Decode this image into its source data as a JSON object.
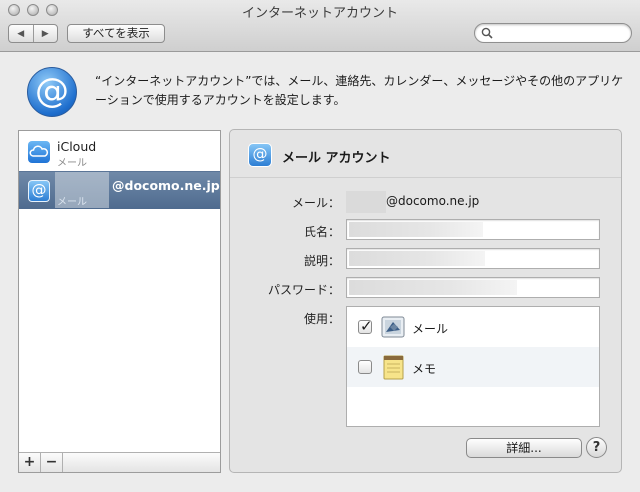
{
  "window": {
    "title": "インターネットアカウント"
  },
  "toolbar": {
    "back": "◀",
    "forward": "▶",
    "show_all_label": "すべてを表示",
    "search_placeholder": ""
  },
  "header": {
    "description": "“インターネットアカウント”では、メール、連絡先、カレンダー、メッセージやその他のアプリケーションで使用するアカウントを設定します。"
  },
  "accounts": [
    {
      "name": "iCloud",
      "sub": "メール"
    },
    {
      "name": "@docomo.ne.jp",
      "sub": "メール"
    }
  ],
  "list_footer": {
    "add": "+",
    "remove": "−"
  },
  "detail": {
    "title": "メール アカウント",
    "mail_label": "メール：",
    "mail_value": "@docomo.ne.jp",
    "name_label": "氏名：",
    "desc_label": "説明：",
    "password_label": "パスワード：",
    "use_label": "使用：",
    "use_items": [
      {
        "label": "メール",
        "checked": true
      },
      {
        "label": "メモ",
        "checked": false
      }
    ],
    "details_button": "詳細...",
    "help_button": "?"
  },
  "colors": {
    "accent": "#2d7ed4",
    "selection": "#5d7798"
  }
}
